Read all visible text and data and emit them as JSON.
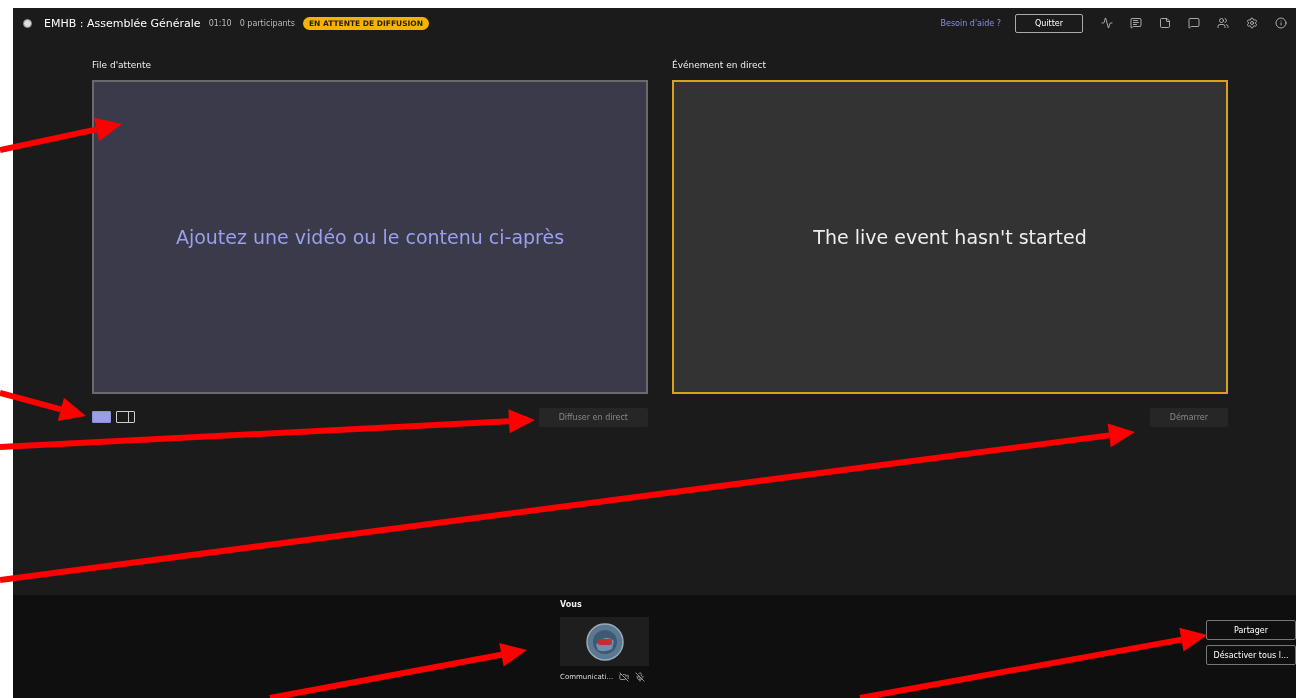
{
  "header": {
    "title": "EMHB : Assemblée Générale",
    "time": "01:10",
    "participants": "0 participants",
    "status_badge": "EN ATTENTE DE DIFFUSION",
    "help_link": "Besoin d'aide ?",
    "quit_button": "Quitter"
  },
  "queue": {
    "title": "File d'attente",
    "message": "Ajoutez une vidéo ou le contenu ci-après",
    "layouts": [
      {
        "selected": true
      },
      {
        "selected": false
      }
    ],
    "action": "Diffuser en direct"
  },
  "live": {
    "title": "Événement en direct",
    "message": "The live event hasn't started",
    "action": "Démarrer"
  },
  "bottom": {
    "section_title": "Vous",
    "participant": {
      "name": "Communicati...",
      "camera_off": true,
      "muted": true
    },
    "buttons": [
      "Partager",
      "Désactiver tous l..."
    ]
  }
}
